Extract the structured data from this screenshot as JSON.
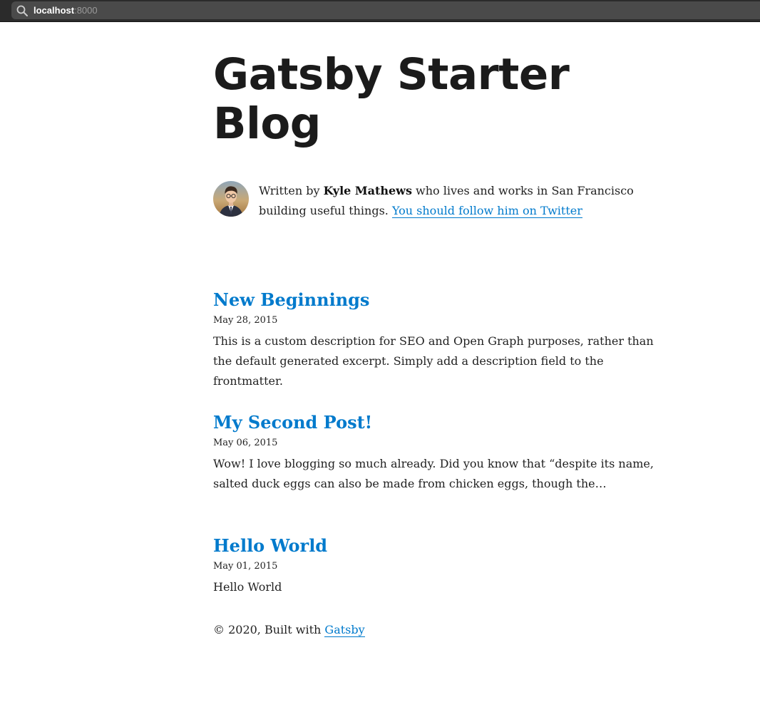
{
  "browser": {
    "url_host": "localhost",
    "url_port": ":8000"
  },
  "site": {
    "title": "Gatsby Starter Blog"
  },
  "bio": {
    "prefix": "Written by ",
    "author": "Kyle Mathews",
    "middle": " who lives and works in San Francisco building useful things. ",
    "twitter_link": "You should follow him on Twitter"
  },
  "posts": [
    {
      "title": "New Beginnings",
      "date": "May 28, 2015",
      "description": "This is a custom description for SEO and Open Graph purposes, rather than the default generated excerpt. Simply add a description field to the frontmatter."
    },
    {
      "title": "My Second Post!",
      "date": "May 06, 2015",
      "description": "Wow! I love blogging so much already. Did you know that “despite its name, salted duck eggs can also be made from chicken eggs, though the…"
    },
    {
      "title": "Hello World",
      "date": "May 01, 2015",
      "description": "Hello World"
    }
  ],
  "footer": {
    "prefix": "© 2020, Built with ",
    "link": "Gatsby"
  },
  "colors": {
    "link": "#007acc",
    "text": "#222222",
    "topbar": "#2b2b2b"
  },
  "icons": {
    "url_search": "search-icon",
    "avatar": "author-avatar"
  }
}
